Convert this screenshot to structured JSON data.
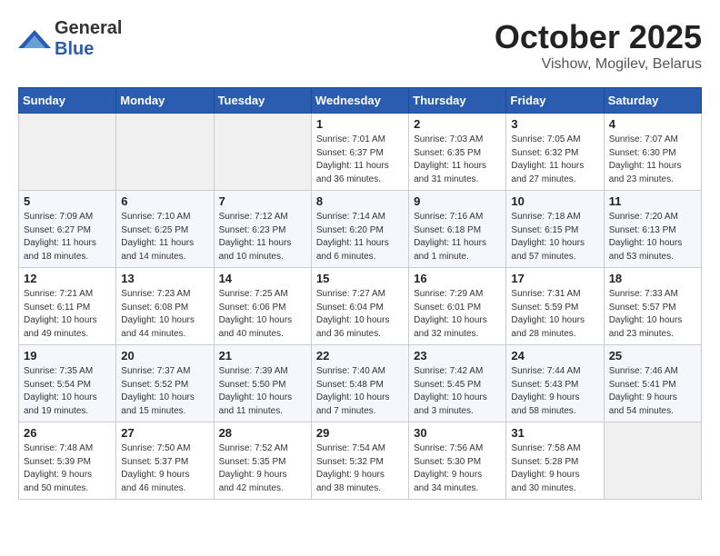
{
  "header": {
    "logo_general": "General",
    "logo_blue": "Blue",
    "month_title": "October 2025",
    "location": "Vishow, Mogilev, Belarus"
  },
  "weekdays": [
    "Sunday",
    "Monday",
    "Tuesday",
    "Wednesday",
    "Thursday",
    "Friday",
    "Saturday"
  ],
  "weeks": [
    [
      {
        "day": "",
        "info": ""
      },
      {
        "day": "",
        "info": ""
      },
      {
        "day": "",
        "info": ""
      },
      {
        "day": "1",
        "info": "Sunrise: 7:01 AM\nSunset: 6:37 PM\nDaylight: 11 hours\nand 36 minutes."
      },
      {
        "day": "2",
        "info": "Sunrise: 7:03 AM\nSunset: 6:35 PM\nDaylight: 11 hours\nand 31 minutes."
      },
      {
        "day": "3",
        "info": "Sunrise: 7:05 AM\nSunset: 6:32 PM\nDaylight: 11 hours\nand 27 minutes."
      },
      {
        "day": "4",
        "info": "Sunrise: 7:07 AM\nSunset: 6:30 PM\nDaylight: 11 hours\nand 23 minutes."
      }
    ],
    [
      {
        "day": "5",
        "info": "Sunrise: 7:09 AM\nSunset: 6:27 PM\nDaylight: 11 hours\nand 18 minutes."
      },
      {
        "day": "6",
        "info": "Sunrise: 7:10 AM\nSunset: 6:25 PM\nDaylight: 11 hours\nand 14 minutes."
      },
      {
        "day": "7",
        "info": "Sunrise: 7:12 AM\nSunset: 6:23 PM\nDaylight: 11 hours\nand 10 minutes."
      },
      {
        "day": "8",
        "info": "Sunrise: 7:14 AM\nSunset: 6:20 PM\nDaylight: 11 hours\nand 6 minutes."
      },
      {
        "day": "9",
        "info": "Sunrise: 7:16 AM\nSunset: 6:18 PM\nDaylight: 11 hours\nand 1 minute."
      },
      {
        "day": "10",
        "info": "Sunrise: 7:18 AM\nSunset: 6:15 PM\nDaylight: 10 hours\nand 57 minutes."
      },
      {
        "day": "11",
        "info": "Sunrise: 7:20 AM\nSunset: 6:13 PM\nDaylight: 10 hours\nand 53 minutes."
      }
    ],
    [
      {
        "day": "12",
        "info": "Sunrise: 7:21 AM\nSunset: 6:11 PM\nDaylight: 10 hours\nand 49 minutes."
      },
      {
        "day": "13",
        "info": "Sunrise: 7:23 AM\nSunset: 6:08 PM\nDaylight: 10 hours\nand 44 minutes."
      },
      {
        "day": "14",
        "info": "Sunrise: 7:25 AM\nSunset: 6:06 PM\nDaylight: 10 hours\nand 40 minutes."
      },
      {
        "day": "15",
        "info": "Sunrise: 7:27 AM\nSunset: 6:04 PM\nDaylight: 10 hours\nand 36 minutes."
      },
      {
        "day": "16",
        "info": "Sunrise: 7:29 AM\nSunset: 6:01 PM\nDaylight: 10 hours\nand 32 minutes."
      },
      {
        "day": "17",
        "info": "Sunrise: 7:31 AM\nSunset: 5:59 PM\nDaylight: 10 hours\nand 28 minutes."
      },
      {
        "day": "18",
        "info": "Sunrise: 7:33 AM\nSunset: 5:57 PM\nDaylight: 10 hours\nand 23 minutes."
      }
    ],
    [
      {
        "day": "19",
        "info": "Sunrise: 7:35 AM\nSunset: 5:54 PM\nDaylight: 10 hours\nand 19 minutes."
      },
      {
        "day": "20",
        "info": "Sunrise: 7:37 AM\nSunset: 5:52 PM\nDaylight: 10 hours\nand 15 minutes."
      },
      {
        "day": "21",
        "info": "Sunrise: 7:39 AM\nSunset: 5:50 PM\nDaylight: 10 hours\nand 11 minutes."
      },
      {
        "day": "22",
        "info": "Sunrise: 7:40 AM\nSunset: 5:48 PM\nDaylight: 10 hours\nand 7 minutes."
      },
      {
        "day": "23",
        "info": "Sunrise: 7:42 AM\nSunset: 5:45 PM\nDaylight: 10 hours\nand 3 minutes."
      },
      {
        "day": "24",
        "info": "Sunrise: 7:44 AM\nSunset: 5:43 PM\nDaylight: 9 hours\nand 58 minutes."
      },
      {
        "day": "25",
        "info": "Sunrise: 7:46 AM\nSunset: 5:41 PM\nDaylight: 9 hours\nand 54 minutes."
      }
    ],
    [
      {
        "day": "26",
        "info": "Sunrise: 7:48 AM\nSunset: 5:39 PM\nDaylight: 9 hours\nand 50 minutes."
      },
      {
        "day": "27",
        "info": "Sunrise: 7:50 AM\nSunset: 5:37 PM\nDaylight: 9 hours\nand 46 minutes."
      },
      {
        "day": "28",
        "info": "Sunrise: 7:52 AM\nSunset: 5:35 PM\nDaylight: 9 hours\nand 42 minutes."
      },
      {
        "day": "29",
        "info": "Sunrise: 7:54 AM\nSunset: 5:32 PM\nDaylight: 9 hours\nand 38 minutes."
      },
      {
        "day": "30",
        "info": "Sunrise: 7:56 AM\nSunset: 5:30 PM\nDaylight: 9 hours\nand 34 minutes."
      },
      {
        "day": "31",
        "info": "Sunrise: 7:58 AM\nSunset: 5:28 PM\nDaylight: 9 hours\nand 30 minutes."
      },
      {
        "day": "",
        "info": ""
      }
    ]
  ]
}
